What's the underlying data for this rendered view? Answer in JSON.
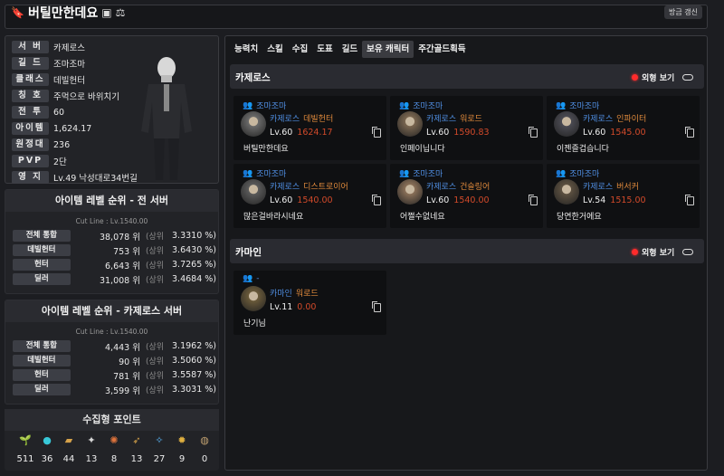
{
  "header": {
    "character_name": "버틸만한데요",
    "refresh_label": "방금 갱신",
    "bookmark_icon": "bookmark-icon",
    "card_icon": "id-card-icon",
    "scale_icon": "scale-icon"
  },
  "profile": [
    {
      "label": "서 버",
      "value": "카제로스"
    },
    {
      "label": "길 드",
      "value": "조마조마"
    },
    {
      "label": "클래스",
      "value": "데빌헌터"
    },
    {
      "label": "칭 호",
      "value": "주먹으로 바위치기"
    },
    {
      "label": "전 투",
      "value": "60"
    },
    {
      "label": "아이템",
      "value": "1,624.17"
    },
    {
      "label": "원정대",
      "value": "236"
    },
    {
      "label": "PVP",
      "value": "2단"
    },
    {
      "label": "영 지",
      "value": "Lv.49 낙성대로34번길"
    }
  ],
  "rank_all": {
    "title": "아이템 레벨 순위 - 전 서버",
    "cutline": "Cut Line : Lv.1540.00",
    "rows": [
      {
        "label": "전체 통합",
        "rank": "38,078 위",
        "sign": "(상위",
        "pct": "3.3310 %)"
      },
      {
        "label": "데빌헌터",
        "rank": "753 위",
        "sign": "(상위",
        "pct": "3.6430 %)"
      },
      {
        "label": "헌터",
        "rank": "6,643 위",
        "sign": "(상위",
        "pct": "3.7265 %)"
      },
      {
        "label": "딜러",
        "rank": "31,008 위",
        "sign": "(상위",
        "pct": "3.4684 %)"
      }
    ]
  },
  "rank_server": {
    "title": "아이템 레벨 순위 - 카제로스 서버",
    "cutline": "Cut Line : Lv.1540.00",
    "rows": [
      {
        "label": "전체 통합",
        "rank": "4,443 위",
        "sign": "(상위",
        "pct": "3.1962 %)"
      },
      {
        "label": "데빌헌터",
        "rank": "90 위",
        "sign": "(상위",
        "pct": "3.5060 %)"
      },
      {
        "label": "헌터",
        "rank": "781 위",
        "sign": "(상위",
        "pct": "3.5587 %)"
      },
      {
        "label": "딜러",
        "rank": "3,599 위",
        "sign": "(상위",
        "pct": "3.3031 %)"
      }
    ]
  },
  "collection": {
    "title": "수집형 포인트",
    "items": [
      {
        "icon": "mokoko-seed-icon",
        "glyph": "🌱",
        "count": "511"
      },
      {
        "icon": "island-heart-icon",
        "glyph": "●",
        "count": "36"
      },
      {
        "icon": "great-art-icon",
        "glyph": "▰",
        "count": "44"
      },
      {
        "icon": "giants-heart-icon",
        "glyph": "✦",
        "count": "13"
      },
      {
        "icon": "omnium-star-icon",
        "glyph": "✺",
        "count": "8"
      },
      {
        "icon": "voyage-icon",
        "glyph": "➶",
        "count": "13"
      },
      {
        "icon": "worldtree-leaf-icon",
        "glyph": "✧",
        "count": "27"
      },
      {
        "icon": "ignea-token-icon",
        "glyph": "✹",
        "count": "9"
      },
      {
        "icon": "orpheus-star-icon",
        "glyph": "◍",
        "count": "0"
      }
    ]
  },
  "tabs": [
    "능력치",
    "스킬",
    "수집",
    "도표",
    "길드",
    "보유 캐릭터",
    "주간골드획득"
  ],
  "active_tab": "보유 캐릭터",
  "appearance_label": "외형 보기",
  "sections": [
    {
      "server": "카제로스",
      "characters": [
        {
          "guild": "조마조마",
          "server": "카제로스",
          "class": "데빌헌터",
          "level": "Lv.60",
          "ilvl": "1624.17",
          "name": "버틸만한데요"
        },
        {
          "guild": "조마조마",
          "server": "카제로스",
          "class": "워로드",
          "level": "Lv.60",
          "ilvl": "1590.83",
          "name": "인페이닙니다"
        },
        {
          "guild": "조마조마",
          "server": "카제로스",
          "class": "인파이터",
          "level": "Lv.60",
          "ilvl": "1545.00",
          "name": "이젠즐겁습니다"
        },
        {
          "guild": "조마조마",
          "server": "카제로스",
          "class": "디스트로이어",
          "level": "Lv.60",
          "ilvl": "1540.00",
          "name": "많은걸바라시네요"
        },
        {
          "guild": "조마조마",
          "server": "카제로스",
          "class": "건슬링어",
          "level": "Lv.60",
          "ilvl": "1540.00",
          "name": "어쩔수없네요"
        },
        {
          "guild": "조마조마",
          "server": "카제로스",
          "class": "버서커",
          "level": "Lv.54",
          "ilvl": "1515.00",
          "name": "당연한거에요"
        }
      ]
    },
    {
      "server": "카마인",
      "characters": [
        {
          "guild": "-",
          "server": "카마인",
          "class": "워로드",
          "level": "Lv.11",
          "ilvl": "0.00",
          "name": "난기님"
        }
      ]
    }
  ]
}
